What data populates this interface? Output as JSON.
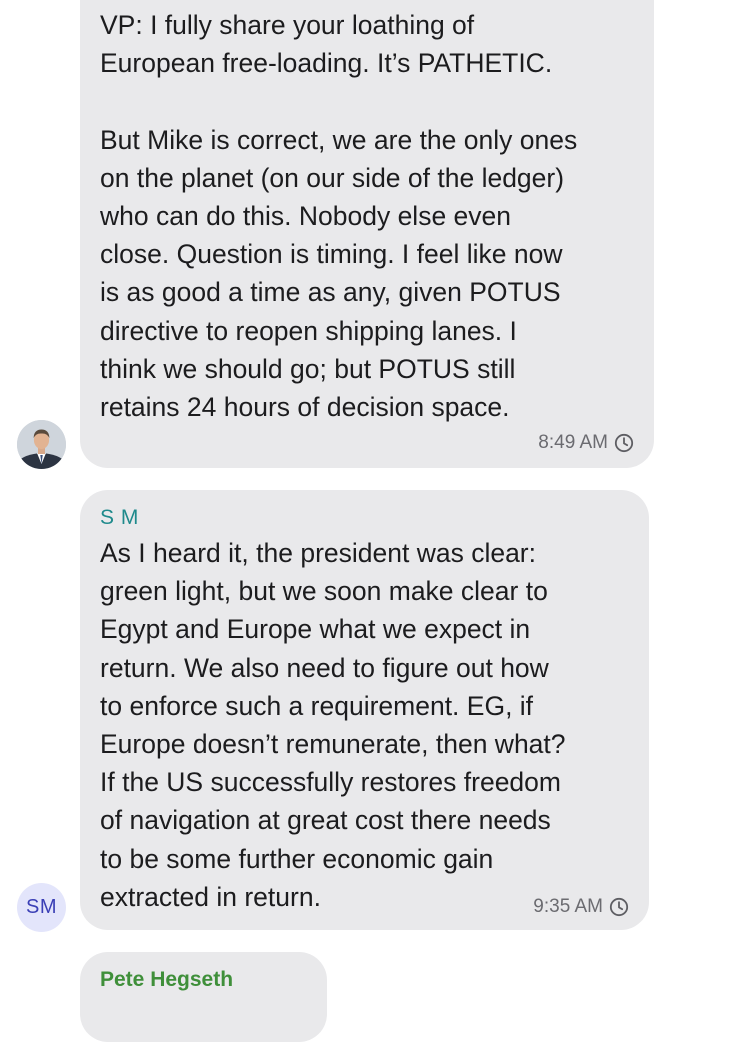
{
  "messages": [
    {
      "text": "VP: I fully share your loathing of\nEuropean free-loading. It’s PATHETIC.\n\nBut Mike is correct, we are the only ones\non the planet (on our side of the ledger)\nwho can do this. Nobody else even\nclose. Question is timing. I feel like now\nis as good a time as any, given POTUS\ndirective to reopen shipping lanes. I\nthink we should go; but POTUS still\nretains 24 hours of decision space.",
      "time": "8:49 AM",
      "avatar_icon": "person-photo-avatar"
    },
    {
      "sender": "S M",
      "text": "As I heard it, the president was clear:\ngreen light, but we soon make clear to\nEgypt and Europe what we expect in\nreturn. We also need to figure out how\nto enforce such a requirement. EG, if\nEurope doesn’t remunerate, then what?\nIf the US successfully restores freedom\nof navigation at great cost there needs\nto be some further economic gain\nextracted in return.",
      "time": "9:35 AM",
      "avatar_initials": "SM"
    },
    {
      "sender": "Pete Hegseth"
    }
  ],
  "colors": {
    "bubble": "#e9e9eb",
    "sender_sm": "#1f8a8c",
    "sender_pete": "#3f8f3a",
    "avatar_sm_bg": "#e3e5fb",
    "avatar_sm_text": "#3a3fb6"
  },
  "icons": {
    "timer": "clock-icon"
  }
}
